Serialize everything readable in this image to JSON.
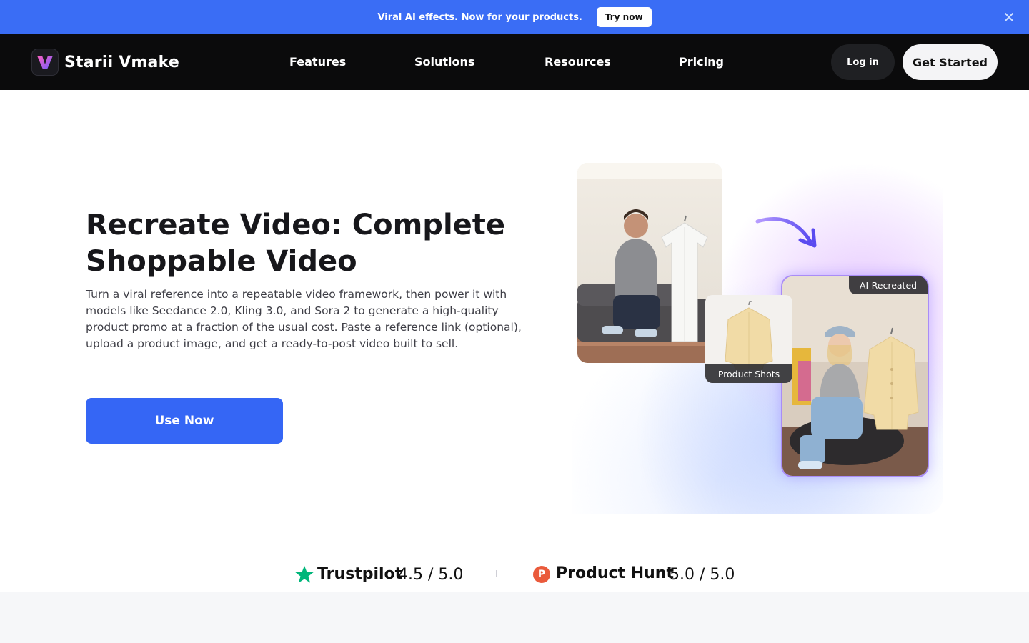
{
  "banner": {
    "text": "Viral AI effects. Now for your products.",
    "cta": "Try now",
    "close_icon": "close-icon",
    "bg_color": "#3a6df5"
  },
  "nav": {
    "brand": "Starii Vmake",
    "links": [
      "Features",
      "Solutions",
      "Resources",
      "Pricing"
    ],
    "login": "Log in",
    "get_started": "Get Started"
  },
  "hero": {
    "title": "Recreate Video: Complete Shoppable Video",
    "description": "Turn a viral reference into a repeatable video framework, then power it with models like Seedance 2.0, Kling 3.0, and Sora 2 to generate a high-quality product promo at a fraction of the usual cost. Paste a reference link (optional), upload a product image, and get a ready-to-post video built to sell.",
    "cta": "Use Now",
    "cta_color": "#3566f5"
  },
  "visual": {
    "tag_ai": "AI-Recreated",
    "tag_product": "Product Shots",
    "arrow_icon": "curved-arrow-icon"
  },
  "ratings": {
    "trustpilot": {
      "name": "Trustpilot",
      "score": "4.5 / 5.0",
      "icon": "star-icon"
    },
    "producthunt": {
      "name": "Product Hunt",
      "score": "5.0 / 5.0",
      "icon": "producthunt-icon",
      "letter": "P"
    }
  }
}
